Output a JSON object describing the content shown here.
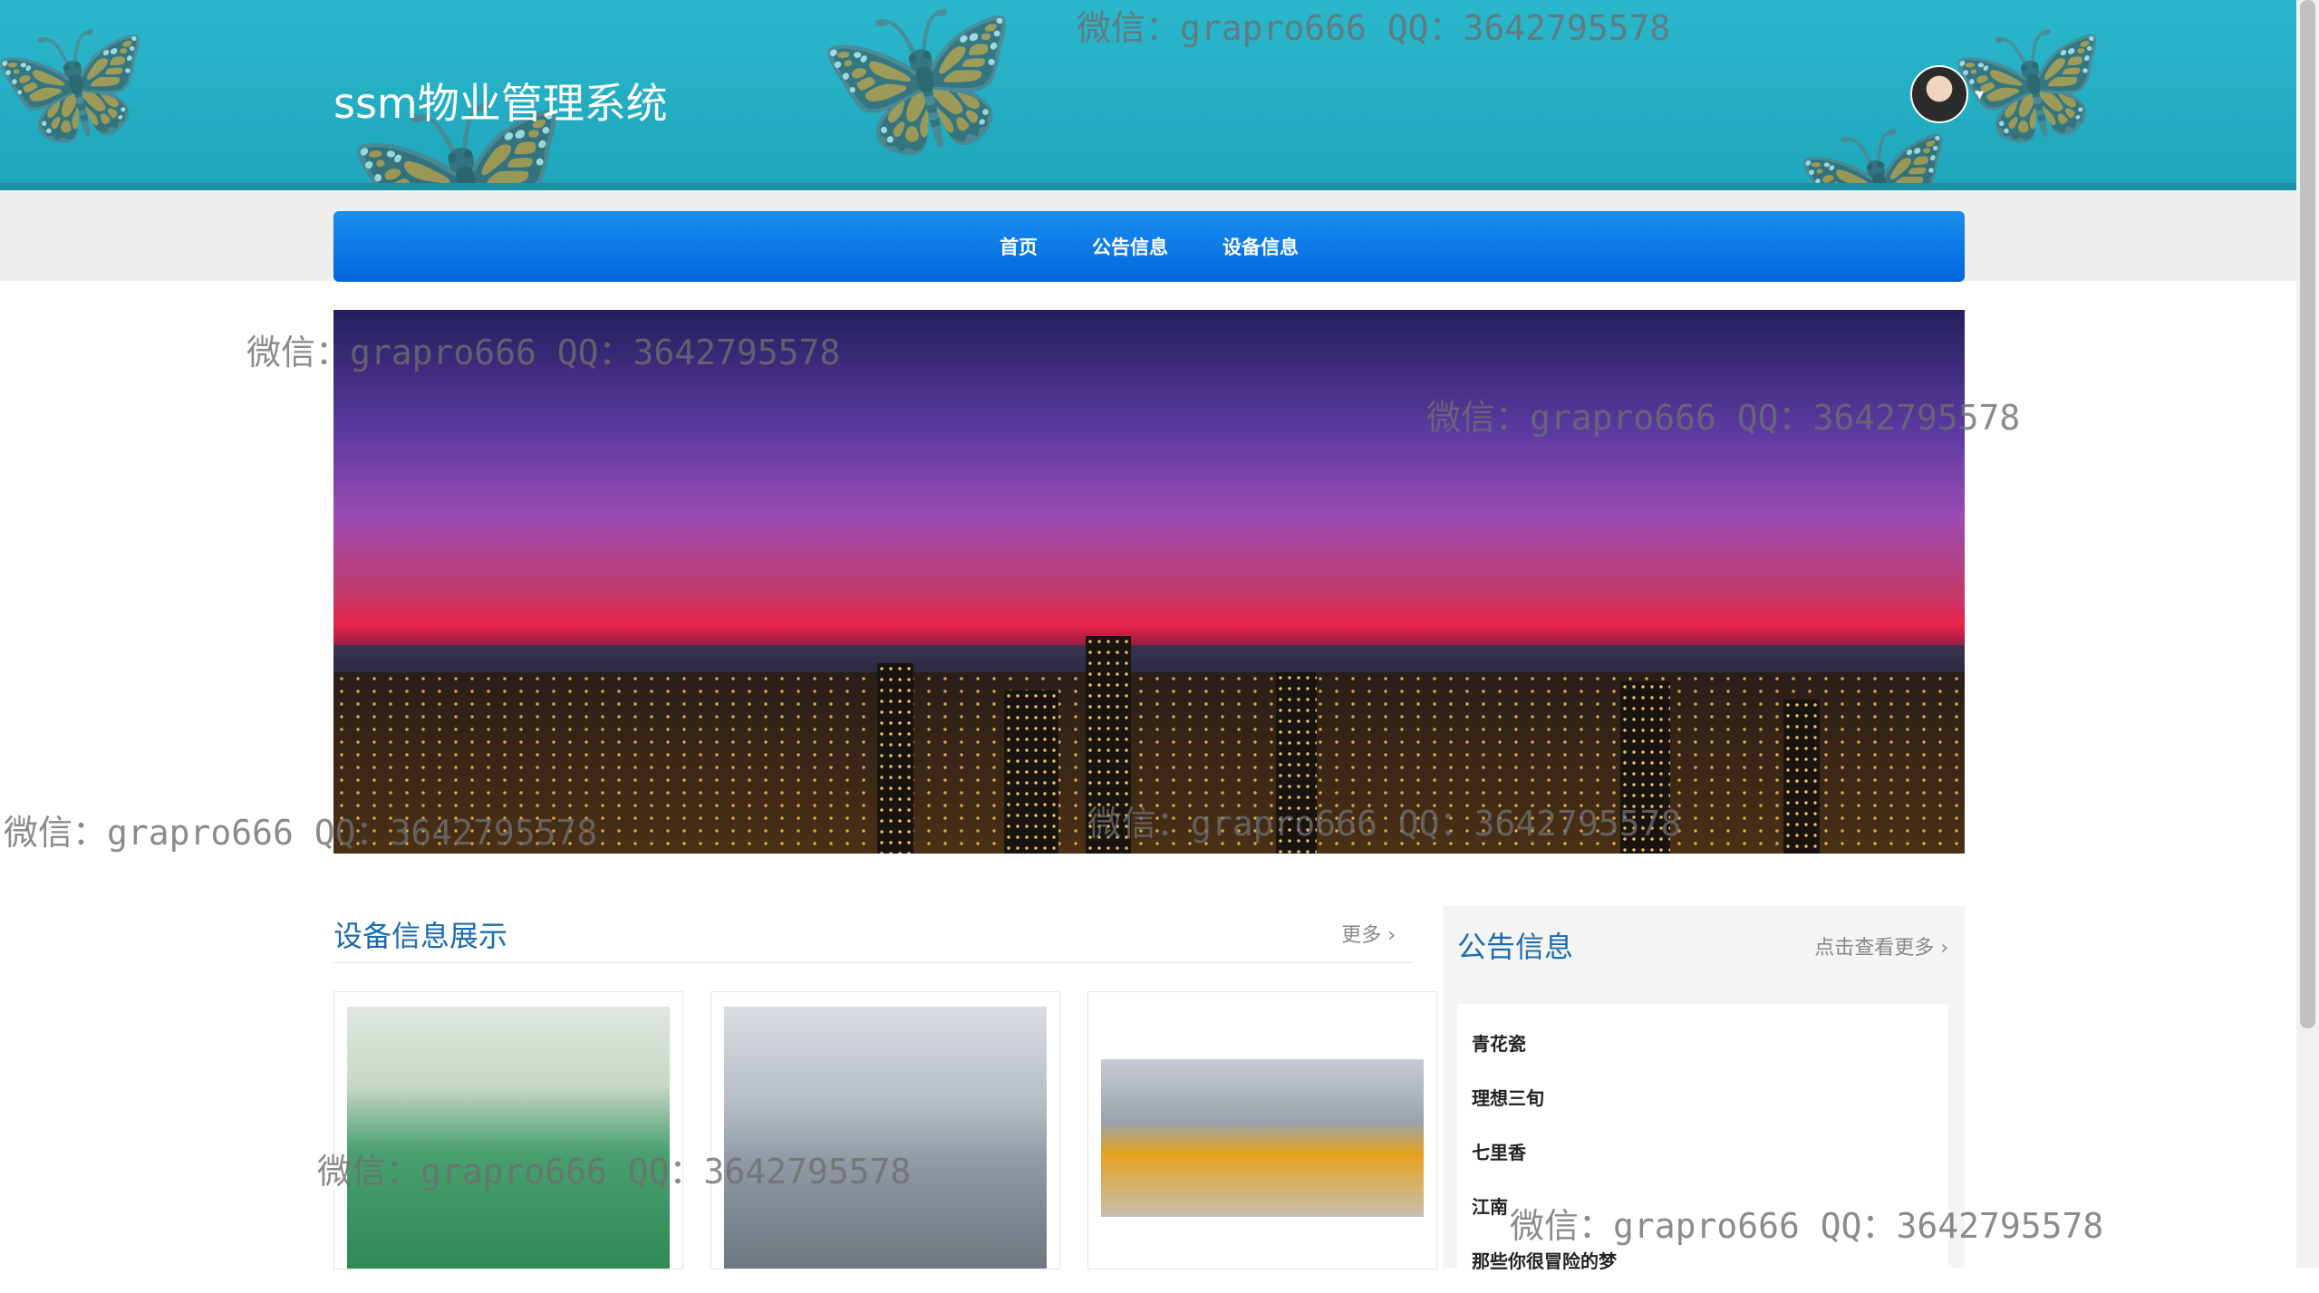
{
  "header": {
    "site_title": "ssm物业管理系统",
    "brand_color": "#2ab7cc"
  },
  "nav": {
    "color": "#0a7ae8",
    "items": [
      {
        "label": "首页"
      },
      {
        "label": "公告信息"
      },
      {
        "label": "设备信息"
      }
    ]
  },
  "devices_section": {
    "title": "设备信息展示",
    "more_label": "更多 ›"
  },
  "notice_section": {
    "title": "公告信息",
    "more_label": "点击查看更多 ›",
    "items": [
      {
        "label": "青花瓷"
      },
      {
        "label": "理想三旬"
      },
      {
        "label": "七里香"
      },
      {
        "label": "江南"
      },
      {
        "label": "那些你很冒险的梦"
      }
    ]
  },
  "watermark": {
    "text": "微信：grapro666 QQ：3642795578"
  },
  "icons": [
    "butterfly-icon",
    "avatar",
    "caret-down-icon",
    "chevron-right-icon"
  ]
}
